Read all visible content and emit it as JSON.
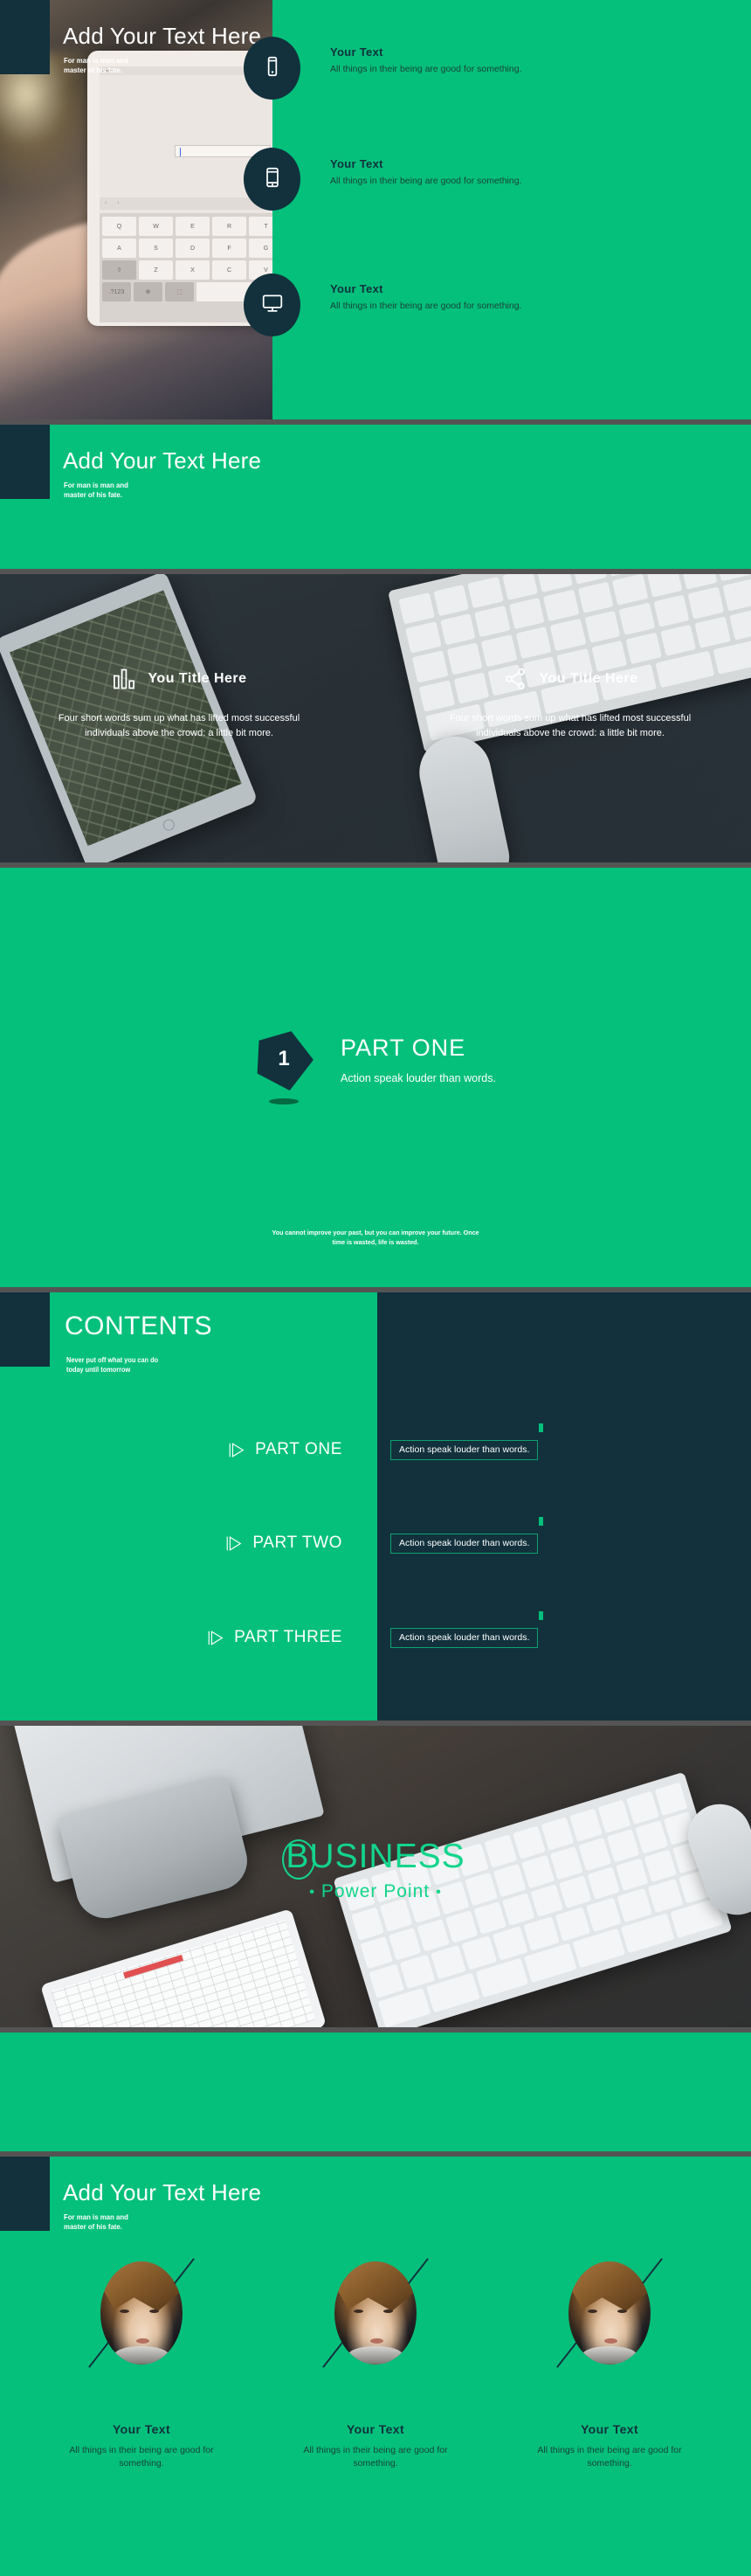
{
  "deck": {
    "accent_green": "#04c07b",
    "navy": "#12313c",
    "bright_green": "#12d58b"
  },
  "slide1": {
    "title": "Add Your Text Here",
    "subtitle": "For man is man and\nmaster of his fate.",
    "items": [
      {
        "icon": "mobile-phone-icon",
        "title": "Your  Text",
        "desc": "All things in their being are good for something."
      },
      {
        "icon": "smartphone-icon",
        "title": "Your  Text",
        "desc": "All things in their being are good for something."
      },
      {
        "icon": "desktop-monitor-icon",
        "title": "Your  Text",
        "desc": "All things in their being are good for something."
      }
    ]
  },
  "slide2": {
    "title": "Add Your Text Here",
    "subtitle": "For man is man and\nmaster of his fate."
  },
  "slide3": {
    "columns": [
      {
        "icon": "bar-chart-icon",
        "title": "You  Title Here",
        "body": "Four short words sum up what has lifted most successful individuals above the crowd: a little bit more."
      },
      {
        "icon": "share-nodes-icon",
        "title": "You  Title Here",
        "body": "Four short words sum up what has lifted most successful individuals above the crowd: a little bit more."
      }
    ]
  },
  "slide4": {
    "number": "1",
    "title": "PART ONE",
    "subtitle": "Action speak louder than words.",
    "footer": "You cannot improve your past, but you can improve your future. Once\ntime is wasted, life is wasted."
  },
  "slide5": {
    "title": "CONTENTS",
    "subtitle": "Never put off what you can do\ntoday until tomorrow",
    "rows": [
      {
        "icon": "play-triangle-icon",
        "label": "PART ONE",
        "note": "Action speak louder than words."
      },
      {
        "icon": "play-triangle-icon",
        "label": "PART TWO",
        "note": "Action speak louder than words."
      },
      {
        "icon": "play-triangle-icon",
        "label": "PART THREE",
        "note": "Action speak louder than words."
      }
    ]
  },
  "slide6": {
    "title": "BUSINESS",
    "subtitle_left_dot": "•",
    "subtitle": "Power  Point",
    "subtitle_right_dot": "•"
  },
  "slide8": {
    "title": "Add Your Text Here",
    "subtitle": "For man is man and\nmaster of his fate.",
    "cards": [
      {
        "avatar": "person-portrait-avatar",
        "title": "Your  Text",
        "desc": "All things in their being are good for something."
      },
      {
        "avatar": "person-portrait-avatar",
        "title": "Your  Text",
        "desc": "All things in their being are good for something."
      },
      {
        "avatar": "person-portrait-avatar",
        "title": "Your  Text",
        "desc": "All things in their being are good for something."
      }
    ]
  }
}
